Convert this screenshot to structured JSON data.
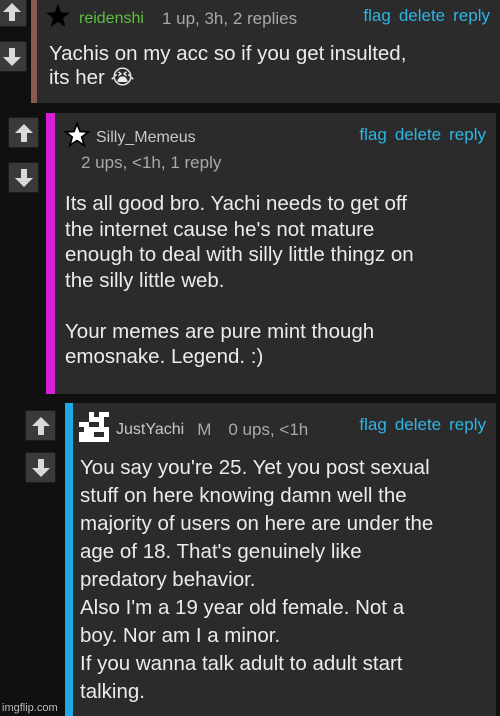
{
  "comments": [
    {
      "username": "reidenshi",
      "username_color": "#5fbf3f",
      "meta": "1 up, 3h, 2 replies",
      "body": "Yachis on my acc so if you get insulted,\nits her 😭",
      "bar_color": "#8a5a52",
      "avatar_icon": "black-star-icon"
    },
    {
      "username": "Silly_Memeus",
      "username_color": "#c8c8c8",
      "meta": "2 ups, <1h, 1 reply",
      "body": "Its all good bro. Yachi needs to get off\nthe internet cause he's not mature\nenough to deal with silly little thingz on\nthe silly little web.\n\nYour memes are pure mint though\nemosnake. Legend. :)",
      "bar_color": "#d61fd6",
      "avatar_icon": "outline-star-icon"
    },
    {
      "username": "JustYachi",
      "username_color": "#c8c8c8",
      "badge": "M",
      "meta": "0 ups, <1h",
      "body": "You say you're 25. Yet you post sexual\nstuff on here knowing damn well the\nmajority of users on here are under the\nage of 18. That's genuinely like\npredatory behavior.\nAlso I'm a 19 year old female. Not a\nboy. Nor am I a minor.\nIf you wanna talk adult to adult start\ntalking.",
      "bar_color": "#1fa9e6",
      "avatar_icon": "pixel-avatar-icon"
    }
  ],
  "actions": {
    "flag": "flag",
    "delete": "delete",
    "reply": "reply"
  },
  "watermark": "imgflip.com",
  "accent": "#2fb4e6"
}
